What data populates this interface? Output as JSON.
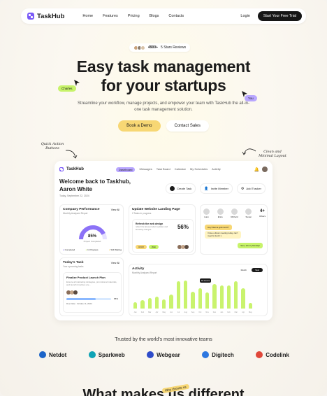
{
  "nav": {
    "logo": "TaskHub",
    "links": [
      "Home",
      "Features",
      "Pricing",
      "Blogs",
      "Contacts"
    ],
    "login": "Login",
    "cta": "Start Your Free Trial"
  },
  "hero": {
    "badge_count": "4900+",
    "badge_text": "5 Stars Reviews",
    "title_line1": "Easy task management",
    "title_line2": "for your startups",
    "subtitle": "Streamline your workflow, manage projects, and empower your team with TaskHub the all-in-one task management solution.",
    "primary_btn": "Book a Demo",
    "secondary_btn": "Contact Sales",
    "tag_lime": "Charles",
    "tag_purple": "You",
    "annotation_left": "Quick Action Buttons",
    "annotation_right": "Clean and Minimal Layout"
  },
  "dashboard": {
    "logo": "TaskHub",
    "tabs": [
      "Dashboard",
      "Messages",
      "Task Board",
      "Calendar",
      "My Schedules",
      "Activity"
    ],
    "welcome": "Welcome back to Taskhub, Aaron White",
    "date": "Today, September 22, 2024",
    "actions": [
      "Create Task",
      "Invite Member",
      "Add Tracker"
    ],
    "performance": {
      "title": "Company Performance",
      "subtitle": "Monthly Analyzed Report",
      "view_all": "View All",
      "percent": "85%",
      "percent_label": "Project Completed",
      "legend": [
        "Completed",
        "In Progress",
        "Still Waiting"
      ]
    },
    "today_task": {
      "title": "Today's Task",
      "subtitle": "Your upcoming tasks",
      "view_all": "View All",
      "task_title": "Finalize Product Launch Plan",
      "task_desc": "Ensure all marketing strategies, promotional materials, and launch timelines are...",
      "progress": 0.65,
      "progress_label": "65%",
      "due": "Due Date : October 3, 2024"
    },
    "landing": {
      "title": "Update Website Landing Page",
      "subtitle": "2 Tasks in progress",
      "task_title": "Refresh the web design",
      "task_desc": "reflect the latest product updates and branding changes.",
      "percent": "56%",
      "chips": [
        "UI/UX",
        "Web"
      ]
    },
    "team": {
      "members": [
        "Liam",
        "Erica",
        "Richard",
        "Susan",
        "Others"
      ],
      "more": "4+",
      "msg1": "Hey! Wanna grab lunch?",
      "msg2": "I have a Zoom meeting today, can't meet for lunch :(",
      "msg3": "Sure, let's try Monday!"
    },
    "activity": {
      "title": "Activity",
      "subtitle": "Monthly Analyzed Report",
      "toggle": [
        "Month",
        "Year"
      ],
      "peak_label": "64 Hours",
      "values": [
        14,
        18,
        22,
        26,
        20,
        30,
        58,
        60,
        36,
        44,
        34,
        52,
        50,
        50,
        58,
        44,
        12
      ],
      "x_labels": [
        "Jan",
        "Feb",
        "Mar",
        "Apr",
        "May",
        "Jun",
        "Jul",
        "Aug",
        "Sep",
        "Oct",
        "Nov",
        "Dec",
        "Jan",
        "Feb",
        "Mar",
        "Apr",
        "May"
      ]
    }
  },
  "trusted": {
    "heading": "Trusted by the world's most innovative teams",
    "brands": [
      {
        "name": "Netdot",
        "color": "#1c64c8"
      },
      {
        "name": "Sparkweb",
        "color": "#0fa3b5"
      },
      {
        "name": "Webgear",
        "color": "#2f4cc9"
      },
      {
        "name": "Digitech",
        "color": "#2d77e0"
      },
      {
        "name": "Codelink",
        "color": "#e0473a"
      }
    ]
  },
  "bottom": {
    "title": "What makes us different",
    "tag": "Why choose us"
  },
  "colors": {
    "accent_purple": "#7a5af8",
    "lavender": "#b9a7ff",
    "lime": "#c7f36a",
    "yellow": "#f7d774",
    "dark": "#161616"
  }
}
